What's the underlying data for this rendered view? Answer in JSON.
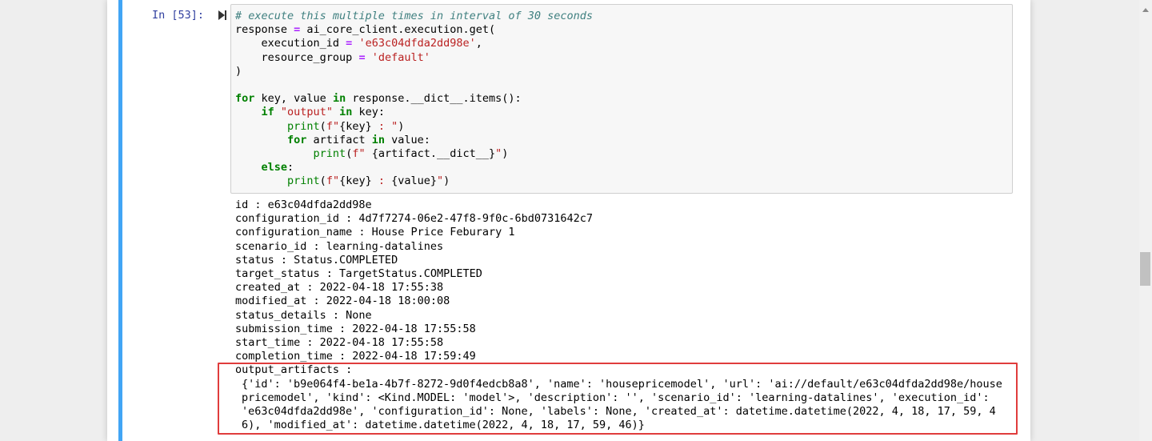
{
  "cell": {
    "prompt": "In [53]:",
    "code_lines": [
      [
        {
          "t": "# execute this multiple times in interval of 30 seconds",
          "c": "cm"
        }
      ],
      [
        {
          "t": "response "
        },
        {
          "t": "=",
          "c": "eq"
        },
        {
          "t": " ai_core_client.execution.get("
        }
      ],
      [
        {
          "t": "    execution_id "
        },
        {
          "t": "=",
          "c": "eq"
        },
        {
          "t": " "
        },
        {
          "t": "'e63c04dfda2dd98e'",
          "c": "st"
        },
        {
          "t": ","
        }
      ],
      [
        {
          "t": "    resource_group "
        },
        {
          "t": "=",
          "c": "eq"
        },
        {
          "t": " "
        },
        {
          "t": "'default'",
          "c": "st"
        }
      ],
      [
        {
          "t": ")"
        }
      ],
      [
        {
          "t": ""
        }
      ],
      [
        {
          "t": "for",
          "c": "kw"
        },
        {
          "t": " key, value "
        },
        {
          "t": "in",
          "c": "kw"
        },
        {
          "t": " response.__dict__.items():"
        }
      ],
      [
        {
          "t": "    "
        },
        {
          "t": "if",
          "c": "kw"
        },
        {
          "t": " "
        },
        {
          "t": "\"output\"",
          "c": "st"
        },
        {
          "t": " "
        },
        {
          "t": "in",
          "c": "kw"
        },
        {
          "t": " key:"
        }
      ],
      [
        {
          "t": "        "
        },
        {
          "t": "print",
          "c": "bi"
        },
        {
          "t": "("
        },
        {
          "t": "f\"",
          "c": "st"
        },
        {
          "t": "{key}"
        },
        {
          "t": " : \"",
          "c": "st"
        },
        {
          "t": ")"
        }
      ],
      [
        {
          "t": "        "
        },
        {
          "t": "for",
          "c": "kw"
        },
        {
          "t": " artifact "
        },
        {
          "t": "in",
          "c": "kw"
        },
        {
          "t": " value:"
        }
      ],
      [
        {
          "t": "            "
        },
        {
          "t": "print",
          "c": "bi"
        },
        {
          "t": "("
        },
        {
          "t": "f\" ",
          "c": "st"
        },
        {
          "t": "{artifact.__dict__}"
        },
        {
          "t": "\"",
          "c": "st"
        },
        {
          "t": ")"
        }
      ],
      [
        {
          "t": "    "
        },
        {
          "t": "else",
          "c": "kw"
        },
        {
          "t": ":"
        }
      ],
      [
        {
          "t": "        "
        },
        {
          "t": "print",
          "c": "bi"
        },
        {
          "t": "("
        },
        {
          "t": "f\"",
          "c": "st"
        },
        {
          "t": "{key}"
        },
        {
          "t": " : ",
          "c": "st"
        },
        {
          "t": "{value}"
        },
        {
          "t": "\"",
          "c": "st"
        },
        {
          "t": ")"
        }
      ]
    ]
  },
  "output": {
    "lines": [
      "id : e63c04dfda2dd98e",
      "configuration_id : 4d7f7274-06e2-47f8-9f0c-6bd0731642c7",
      "configuration_name : House Price Feburary 1",
      "scenario_id : learning-datalines",
      "status : Status.COMPLETED",
      "target_status : TargetStatus.COMPLETED",
      "created_at : 2022-04-18 17:55:38",
      "modified_at : 2022-04-18 18:00:08",
      "status_details : None",
      "submission_time : 2022-04-18 17:55:58",
      "start_time : 2022-04-18 17:55:58",
      "completion_time : 2022-04-18 17:59:49",
      "output_artifacts :"
    ],
    "artifact": "{'id': 'b9e064f4-be1a-4b7f-8272-9d0f4edcb8a8', 'name': 'housepricemodel', 'url': 'ai://default/e63c04dfda2dd98e/housepricemodel', 'kind': <Kind.MODEL: 'model'>, 'description': '', 'scenario_id': 'learning-datalines', 'execution_id': 'e63c04dfda2dd98e', 'configuration_id': None, 'labels': None, 'created_at': datetime.datetime(2022, 4, 18, 17, 59, 46), 'modified_at': datetime.datetime(2022, 4, 18, 17, 59, 46)}"
  },
  "colors": {
    "cell_bar": "#42a5f5",
    "prompt": "#303f9f",
    "highlight_border": "#e03c3c"
  },
  "icons": {
    "run": "run-cell-icon"
  }
}
